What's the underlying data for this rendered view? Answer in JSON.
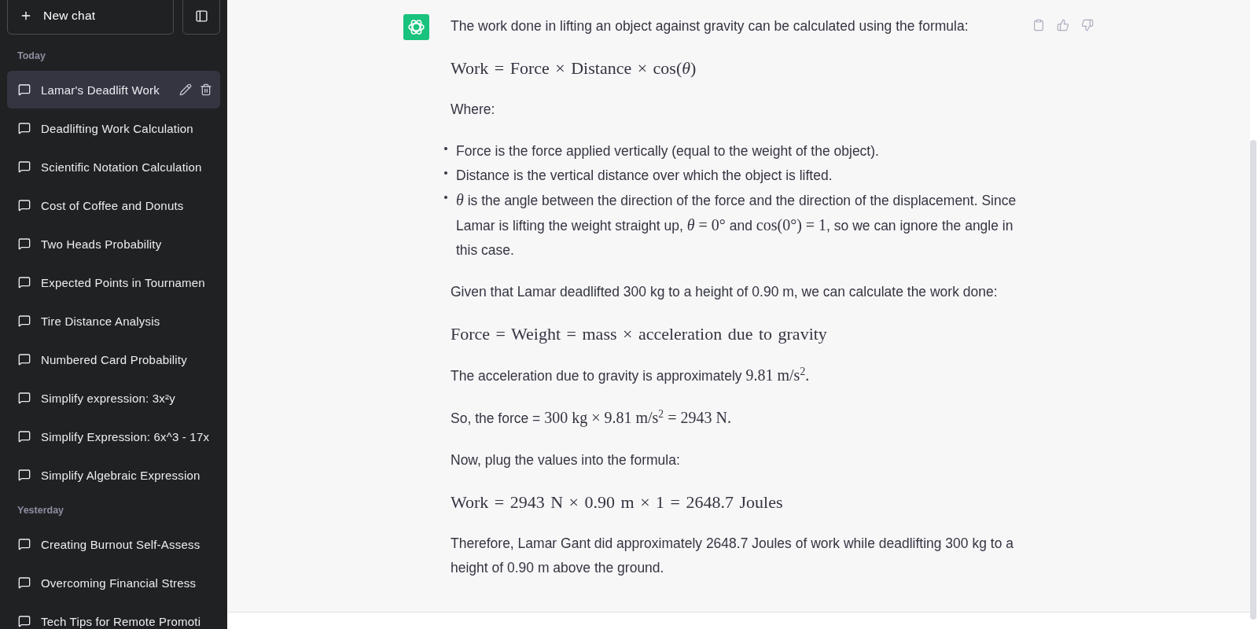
{
  "sidebar": {
    "new_chat_button": {
      "label": "New chat"
    },
    "sections": [
      {
        "label": "Today",
        "items": [
          {
            "title": "Lamar's Deadlift Work",
            "selected": true
          },
          {
            "title": "Deadlifting Work Calculation",
            "selected": false
          },
          {
            "title": "Scientific Notation Calculation",
            "selected": false
          },
          {
            "title": "Cost of Coffee and Donuts",
            "selected": false
          },
          {
            "title": "Two Heads Probability",
            "selected": false
          },
          {
            "title": "Expected Points in Tournamen",
            "selected": false
          },
          {
            "title": "Tire Distance Analysis",
            "selected": false
          },
          {
            "title": "Numbered Card Probability",
            "selected": false
          },
          {
            "title": "Simplify expression: 3x²y",
            "selected": false
          },
          {
            "title": "Simplify Expression: 6x^3 - 17x",
            "selected": false
          },
          {
            "title": "Simplify Algebraic Expression",
            "selected": false
          }
        ]
      },
      {
        "label": "Yesterday",
        "items": [
          {
            "title": "Creating Burnout Self-Assess",
            "selected": false
          },
          {
            "title": "Overcoming Financial Stress",
            "selected": false
          },
          {
            "title": "Tech Tips for Remote Promoti",
            "selected": false
          }
        ]
      }
    ]
  },
  "message": {
    "blocks": [
      {
        "kind": "paragraph",
        "segments": [
          {
            "kind": "text",
            "text": "The work done in lifting an object against gravity can be calculated using the formula:"
          }
        ]
      },
      {
        "kind": "formula",
        "text": "Work = Force × Distance × cos(*θ*)"
      },
      {
        "kind": "paragraph",
        "segments": [
          {
            "kind": "text",
            "text": "Where:"
          }
        ]
      },
      {
        "kind": "list",
        "items": [
          {
            "segments": [
              {
                "kind": "text",
                "text": "Force is the force applied vertically (equal to the weight of the object)."
              }
            ]
          },
          {
            "segments": [
              {
                "kind": "text",
                "text": "Distance is the vertical distance over which the object is lifted."
              }
            ]
          },
          {
            "segments": [
              {
                "kind": "math",
                "text": "*θ*"
              },
              {
                "kind": "text",
                "text": " is the angle between the direction of the force and the direction of the displacement. Since Lamar is lifting the weight straight up, "
              },
              {
                "kind": "math",
                "text": "*θ* = 0°"
              },
              {
                "kind": "text",
                "text": " and "
              },
              {
                "kind": "math",
                "text": "cos(0°) = 1"
              },
              {
                "kind": "text",
                "text": ", so we can ignore the angle in this case."
              }
            ]
          }
        ]
      },
      {
        "kind": "paragraph",
        "segments": [
          {
            "kind": "text",
            "text": "Given that Lamar deadlifted 300 kg to a height of 0.90 m, we can calculate the work done:"
          }
        ]
      },
      {
        "kind": "formula",
        "text": "Force = Weight = mass × acceleration due to gravity"
      },
      {
        "kind": "paragraph",
        "segments": [
          {
            "kind": "text",
            "text": "The acceleration due to gravity is approximately "
          },
          {
            "kind": "math",
            "text": "9.81 m/s$^{2}$."
          }
        ]
      },
      {
        "kind": "paragraph",
        "segments": [
          {
            "kind": "text",
            "text": "So, the force = "
          },
          {
            "kind": "math",
            "text": "300 kg × 9.81 m/s$^{2}$ = 2943 N."
          }
        ]
      },
      {
        "kind": "paragraph",
        "segments": [
          {
            "kind": "text",
            "text": "Now, plug the values into the formula:"
          }
        ]
      },
      {
        "kind": "formula",
        "text": "Work = 2943 N × 0.90 m × 1 = 2648.7 Joules"
      },
      {
        "kind": "paragraph",
        "segments": [
          {
            "kind": "text",
            "text": "Therefore, Lamar Gant did approximately 2648.7 Joules of work while deadlifting 300 kg to a height of 0.90 m above the ground."
          }
        ]
      }
    ]
  }
}
